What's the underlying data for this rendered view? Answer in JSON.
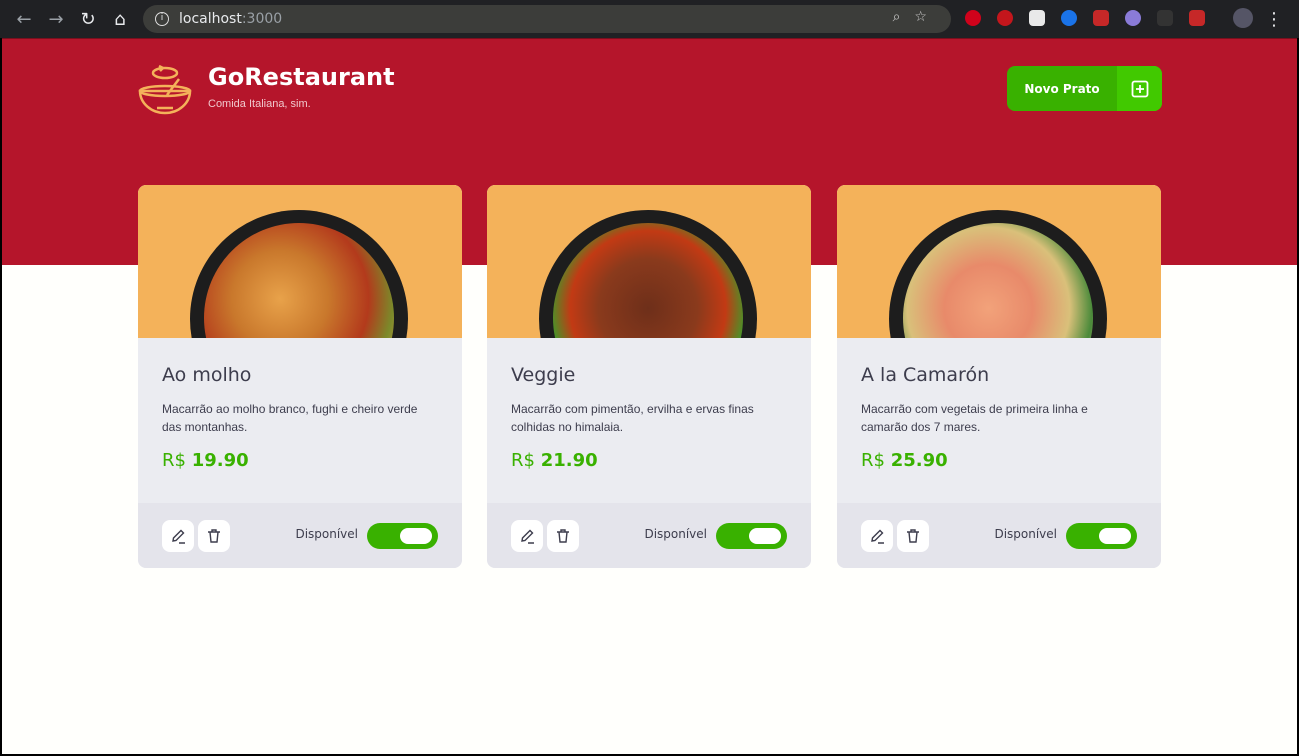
{
  "browser": {
    "url_host": "localhost",
    "url_port": ":3000"
  },
  "header": {
    "brand": "GoRestaurant",
    "tagline": "Comida Italiana, sim.",
    "new_button": "Novo Prato"
  },
  "foods": [
    {
      "name": "Ao molho",
      "description": "Macarrão ao molho branco, fughi e cheiro verde das montanhas.",
      "currency": "R$",
      "price": "19.90",
      "available_label": "Disponível",
      "available": true
    },
    {
      "name": "Veggie",
      "description": "Macarrão com pimentão, ervilha e ervas finas colhidas no himalaia.",
      "currency": "R$",
      "price": "21.90",
      "available_label": "Disponível",
      "available": true
    },
    {
      "name": "A la Camarón",
      "description": "Macarrão com vegetais de primeira linha e camarão dos 7 mares.",
      "currency": "R$",
      "price": "25.90",
      "available_label": "Disponível",
      "available": true
    }
  ],
  "colors": {
    "brand_red": "#b5152b",
    "green": "#39b100",
    "image_bg": "#f4b25a"
  }
}
